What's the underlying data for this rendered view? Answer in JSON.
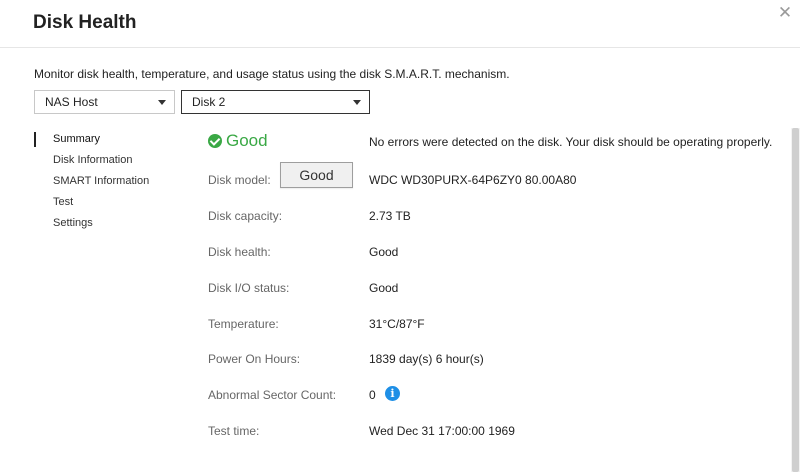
{
  "dialog": {
    "title": "Disk Health",
    "description": "Monitor disk health, temperature, and usage status using the disk S.M.A.R.T. mechanism."
  },
  "selectors": {
    "host": "NAS Host",
    "disk": "Disk 2"
  },
  "nav": {
    "items": [
      "Summary",
      "Disk Information",
      "SMART Information",
      "Test",
      "Settings"
    ],
    "active": "Summary"
  },
  "summary": {
    "status": "Good",
    "status_message": "No errors were detected on the disk. Your disk should be operating properly.",
    "good_button_label": "Good",
    "rows": [
      {
        "label": "Disk model:",
        "value": "WDC WD30PURX-64P6ZY0 80.00A80"
      },
      {
        "label": "Disk capacity:",
        "value": "2.73 TB"
      },
      {
        "label": "Disk health:",
        "value": "Good"
      },
      {
        "label": "Disk I/O status:",
        "value": "Good"
      },
      {
        "label": "Temperature:",
        "value": "31°C/87°F"
      },
      {
        "label": "Power On Hours:",
        "value": "1839 day(s) 6 hour(s)"
      },
      {
        "label": "Abnormal Sector Count:",
        "value": "0"
      },
      {
        "label": "Test time:",
        "value": "Wed Dec 31 17:00:00 1969"
      }
    ]
  },
  "colors": {
    "good": "#3aa845",
    "info": "#1e8fe6"
  },
  "icons": {
    "close": "close-icon",
    "status": "check-circle-icon",
    "info": "info-icon"
  }
}
